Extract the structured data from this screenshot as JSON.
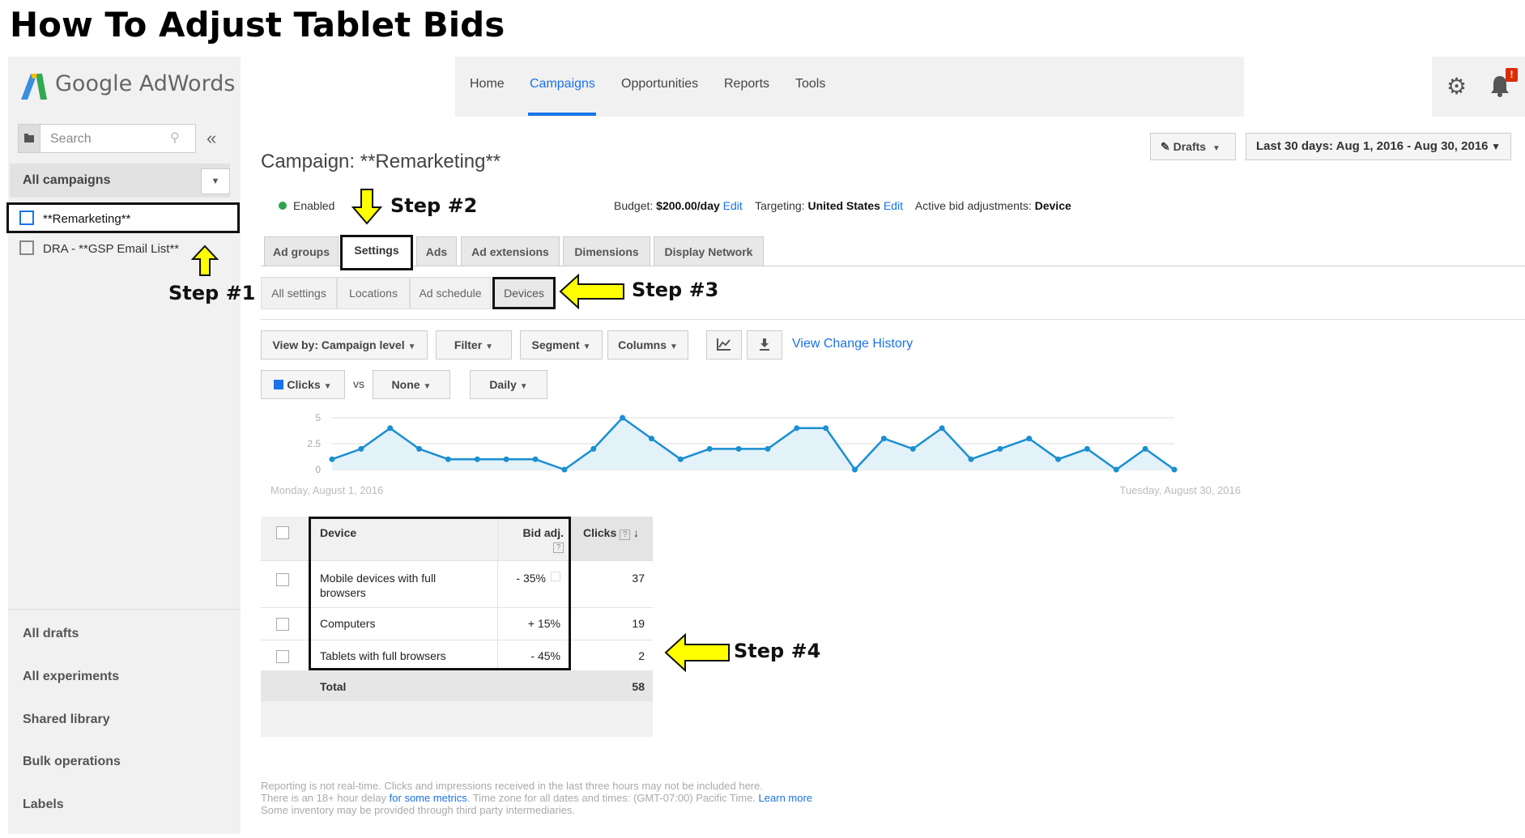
{
  "heading": "How To Adjust Tablet Bids",
  "app": {
    "logo_text": "Google AdWords"
  },
  "sidebar": {
    "search_placeholder": "Search",
    "all_campaigns": "All campaigns",
    "campaigns": [
      "**Remarketing**",
      "DRA - **GSP Email List**"
    ],
    "bottom_nav": [
      "All drafts",
      "All experiments",
      "Shared library",
      "Bulk operations",
      "Labels"
    ]
  },
  "topnav": {
    "items": [
      "Home",
      "Campaigns",
      "Opportunities",
      "Reports",
      "Tools"
    ],
    "active": "Campaigns",
    "notification_badge": "!"
  },
  "header": {
    "drafts_label": "Drafts",
    "date_range": "Last 30 days: Aug 1, 2016 - Aug 30, 2016",
    "campaign_title": "Campaign: **Remarketing**",
    "status": "Enabled",
    "budget_label": "Budget:",
    "budget_value": "$200.00/day",
    "edit_label": "Edit",
    "targeting_label": "Targeting:",
    "targeting_value": "United States",
    "bid_adj_label": "Active bid adjustments:",
    "bid_adj_value": "Device"
  },
  "tabs": [
    "Ad groups",
    "Settings",
    "Ads",
    "Ad extensions",
    "Dimensions",
    "Display Network"
  ],
  "subtabs": [
    "All settings",
    "Locations",
    "Ad schedule",
    "Devices"
  ],
  "toolbar": {
    "view_by": "View by: Campaign level",
    "filter": "Filter",
    "segment": "Segment",
    "columns": "Columns",
    "view_change_history": "View Change History",
    "metric1": "Clicks",
    "vs": "vs",
    "metric2": "None",
    "interval": "Daily"
  },
  "steps": [
    "Step #1",
    "Step #2",
    "Step #3",
    "Step #4"
  ],
  "chart_data": {
    "type": "area",
    "series": [
      {
        "name": "Clicks",
        "values": [
          1,
          2,
          4,
          2,
          1,
          1,
          1,
          1,
          0,
          2,
          5,
          3,
          1,
          2,
          2,
          2,
          4,
          4,
          0,
          3,
          2,
          4,
          1,
          2,
          3,
          1,
          2,
          0,
          2,
          0
        ]
      }
    ],
    "ylim": [
      0,
      5
    ],
    "yticks": [
      "0",
      "2.5",
      "5"
    ],
    "x_start_label": "Monday, August 1, 2016",
    "x_end_label": "Tuesday, August 30, 2016",
    "color": "#1a8fd1"
  },
  "table": {
    "headers": {
      "device": "Device",
      "bid_adj": "Bid adj.",
      "clicks": "Clicks"
    },
    "rows": [
      {
        "device": "Mobile devices with full browsers",
        "bid_adj": "- 35%",
        "clicks": "37"
      },
      {
        "device": "Computers",
        "bid_adj": "+ 15%",
        "clicks": "19"
      },
      {
        "device": "Tablets with full browsers",
        "bid_adj": "- 45%",
        "clicks": "2"
      }
    ],
    "total_label": "Total",
    "total_clicks": "58"
  },
  "footer": {
    "line1": "Reporting is not real-time. Clicks and impressions received in the last three hours may not be included here.",
    "line2_a": "There is an 18+ hour delay",
    "line2_link": "for some metrics",
    "line2_b": ". Time zone for all dates and times: (GMT-07:00) Pacific Time.",
    "learn_more": "Learn more",
    "line3": "Some inventory may be provided through third party intermediaries."
  }
}
